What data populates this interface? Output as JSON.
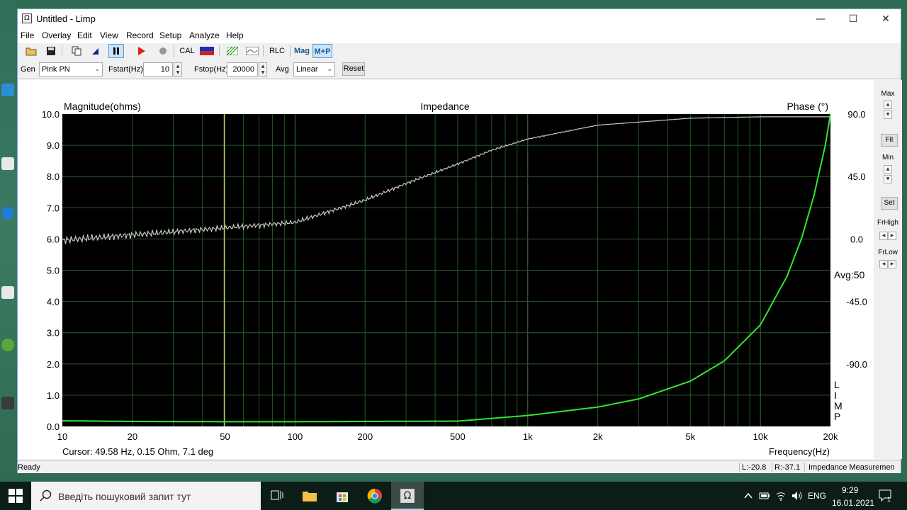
{
  "window": {
    "title": "Untitled - Limp",
    "app_icon": "Ω",
    "minimize": "—",
    "maximize": "☐",
    "close": "✕"
  },
  "menu": [
    "File",
    "Overlay",
    "Edit",
    "View",
    "Record",
    "Setup",
    "Analyze",
    "Help"
  ],
  "toolbar": {
    "cal": "CAL",
    "rlc": "RLC",
    "mag": "Mag",
    "mp": "M+P"
  },
  "params": {
    "gen_label": "Gen",
    "gen_value": "Pink PN",
    "fstart_label": "Fstart(Hz)",
    "fstart_value": "10",
    "fstop_label": "Fstop(Hz)",
    "fstop_value": "20000",
    "avg_label": "Avg",
    "avg_value": "Linear",
    "reset_label": "Reset"
  },
  "side_panel": {
    "max": "Max",
    "fit": "Fit",
    "min": "Min",
    "set": "Set",
    "frhigh": "FrHigh",
    "frlow": "FrLow"
  },
  "plot": {
    "left_title": "Magnitude(ohms)",
    "center_title": "Impedance",
    "right_title": "Phase (°)",
    "avg_text": "Avg:50",
    "limp_letters": [
      "L",
      "I",
      "M",
      "P"
    ],
    "cursor_text": "Cursor: 49.58 Hz, 0.15 Ohm, 7.1 deg",
    "xlabel": "Frequency(Hz)"
  },
  "chart_data": {
    "type": "line",
    "title": "Impedance",
    "xlabel": "Frequency(Hz)",
    "ylabel": "Magnitude(ohms)",
    "y2label": "Phase (°)",
    "xscale": "log",
    "xlim": [
      10,
      20000
    ],
    "ylim": [
      0,
      10
    ],
    "y2lim": [
      -135,
      90
    ],
    "x_ticks": [
      10,
      20,
      50,
      100,
      200,
      500,
      1000,
      2000,
      5000,
      10000,
      20000
    ],
    "x_tick_labels": [
      "10",
      "20",
      "50",
      "100",
      "200",
      "500",
      "1k",
      "2k",
      "5k",
      "10k",
      "20k"
    ],
    "y_ticks": [
      "10.0",
      "9.0",
      "8.0",
      "7.0",
      "6.0",
      "5.0",
      "4.0",
      "3.0",
      "2.0",
      "1.0",
      "0.0"
    ],
    "y2_ticks": [
      "90.0",
      "45.0",
      "0.0",
      "-45.0",
      "-90.0"
    ],
    "grid": true,
    "cursor_x": 49.58,
    "series": [
      {
        "name": "Magnitude",
        "color": "#2ee82e",
        "x": [
          10,
          20,
          50,
          100,
          200,
          500,
          1000,
          2000,
          3000,
          5000,
          7000,
          10000,
          13000,
          15000,
          17000,
          19000,
          20000
        ],
        "y": [
          0.18,
          0.16,
          0.15,
          0.15,
          0.16,
          0.17,
          0.35,
          0.62,
          0.88,
          1.45,
          2.1,
          3.25,
          4.8,
          6.0,
          7.4,
          9.0,
          10.0
        ]
      },
      {
        "name": "Phase",
        "color": "#c8c8c8",
        "x": [
          10,
          20,
          50,
          100,
          200,
          300,
          500,
          700,
          1000,
          2000,
          5000,
          10000,
          20000
        ],
        "y": [
          -1,
          3,
          8,
          12,
          28,
          40,
          54,
          64,
          72,
          82,
          87,
          88,
          88
        ]
      }
    ]
  },
  "status": {
    "ready": "Ready",
    "left": "L:-20.8",
    "right": "R:-37.1",
    "mode": "Impedance Measuremen"
  },
  "taskbar": {
    "search_placeholder": "Введіть пошуковий запит тут",
    "lang": "ENG",
    "time": "9:29",
    "date": "16.01.2021",
    "notif_count": "1"
  }
}
